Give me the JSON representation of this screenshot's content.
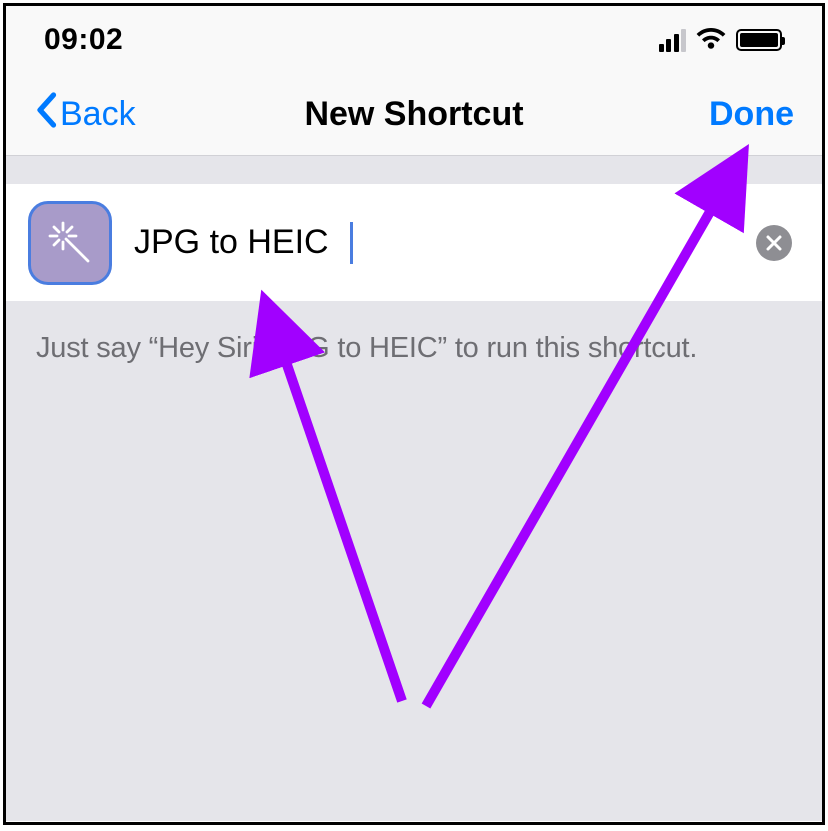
{
  "status_bar": {
    "time": "09:02"
  },
  "nav": {
    "back_label": "Back",
    "title": "New Shortcut",
    "done_label": "Done"
  },
  "shortcut": {
    "name": "JPG to HEIC",
    "icon_name": "magic-wand-icon"
  },
  "hint": {
    "text": "Just say “Hey Siri, JPG to HEIC” to run this shortcut."
  },
  "colors": {
    "ios_blue": "#007aff",
    "icon_bg": "#a89bc9",
    "annotation_purple": "#a100ff"
  }
}
